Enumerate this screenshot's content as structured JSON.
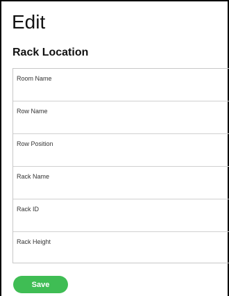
{
  "page": {
    "title": "Edit",
    "section_title": "Rack Location"
  },
  "fields": [
    {
      "label": "Room Name",
      "value": "",
      "placeholder": ""
    },
    {
      "label": "Row Name",
      "value": "",
      "placeholder": ""
    },
    {
      "label": "Row Position",
      "value": "",
      "placeholder": ""
    },
    {
      "label": "Rack Name",
      "value": "",
      "placeholder": ""
    },
    {
      "label": "Rack ID",
      "value": "",
      "placeholder": ""
    },
    {
      "label": "Rack Height",
      "value": "",
      "placeholder": ""
    }
  ],
  "actions": {
    "save_label": "Save"
  },
  "colors": {
    "save_button": "#3fbd54"
  }
}
